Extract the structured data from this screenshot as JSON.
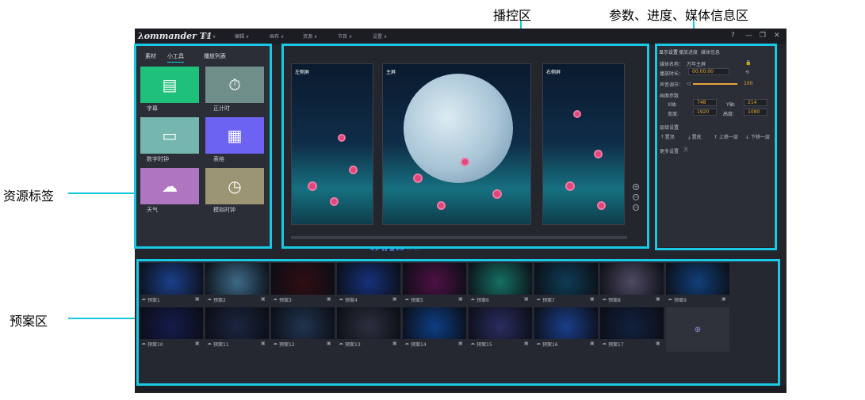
{
  "annotations": {
    "playback_area": "播控区",
    "info_area": "参数、进度、媒体信息区",
    "resource_tabs": "资源标签",
    "plan_area": "预案区"
  },
  "app": {
    "logo": "ommander T1",
    "menu": [
      "文件 ∨",
      "编辑 ∨",
      "画布 ∨",
      "资源 ∨",
      "节目 ∨",
      "设置 ∨"
    ],
    "win_controls": {
      "help": "?",
      "minimize": "—",
      "restore": "❐",
      "close": "✕"
    }
  },
  "resources": {
    "tabs": [
      "素材",
      "小工具",
      "播放列表"
    ],
    "active_tab": "小工具",
    "tools": [
      {
        "label": "字幕",
        "icon": "document-icon",
        "color": "#1ec07a"
      },
      {
        "label": "正计时",
        "icon": "stopwatch-icon",
        "color": "#6f8e89"
      },
      {
        "label": "数字时钟",
        "icon": "digital-clock-icon",
        "color": "#75b7ae"
      },
      {
        "label": "表格",
        "icon": "table-icon",
        "color": "#6c63f3"
      },
      {
        "label": "天气",
        "icon": "weather-icon",
        "color": "#b075c0"
      },
      {
        "label": "模拟时钟",
        "icon": "analog-clock-icon",
        "color": "#9c9574"
      }
    ]
  },
  "preview": {
    "screens": [
      "左侧屏",
      "主屏",
      "右侧屏"
    ],
    "zoom_controls": [
      "+",
      "−",
      "−"
    ]
  },
  "info": {
    "tabs": [
      "显示设置",
      "播放进度",
      "媒体信息"
    ],
    "media_name_label": "媒体名称：",
    "media_name": "万年主屏",
    "duration_label": "播放时长：",
    "duration": "00:00:00",
    "volume_label": "声音调节：",
    "volume": "100",
    "volume_fraction": 1.0,
    "params_label": "画面参数",
    "x_label": "X轴:",
    "x_value": "748",
    "y_label": "Y轴:",
    "y_value": "214",
    "width_label": "宽度:",
    "width_value": "1920",
    "height_label": "高度:",
    "height_value": "1080",
    "layer_label": "层级设置",
    "layer_buttons": [
      "置顶",
      "置底",
      "上移一层",
      "下移一层"
    ],
    "more_label": "更多设置"
  },
  "plans": {
    "row1": [
      "预案1",
      "预案2",
      "预案3",
      "预案4",
      "预案5",
      "预案6",
      "预案7",
      "预案8",
      "预案9"
    ],
    "row2": [
      "预案10",
      "预案11",
      "预案12",
      "预案13",
      "预案14",
      "预案15",
      "预案16",
      "预案17"
    ],
    "row1_colors": [
      "#1b3f8a",
      "#3d6a88",
      "#300d14",
      "#16317a",
      "#4d1045",
      "#157063",
      "#0e3c55",
      "#4e4a62",
      "#103f79"
    ],
    "row2_colors": [
      "#141b4c",
      "#1b2540",
      "#20344f",
      "#2c2f3e",
      "#0c3e84",
      "#2a2c5f",
      "#1a3f8a",
      "#12213f"
    ]
  }
}
